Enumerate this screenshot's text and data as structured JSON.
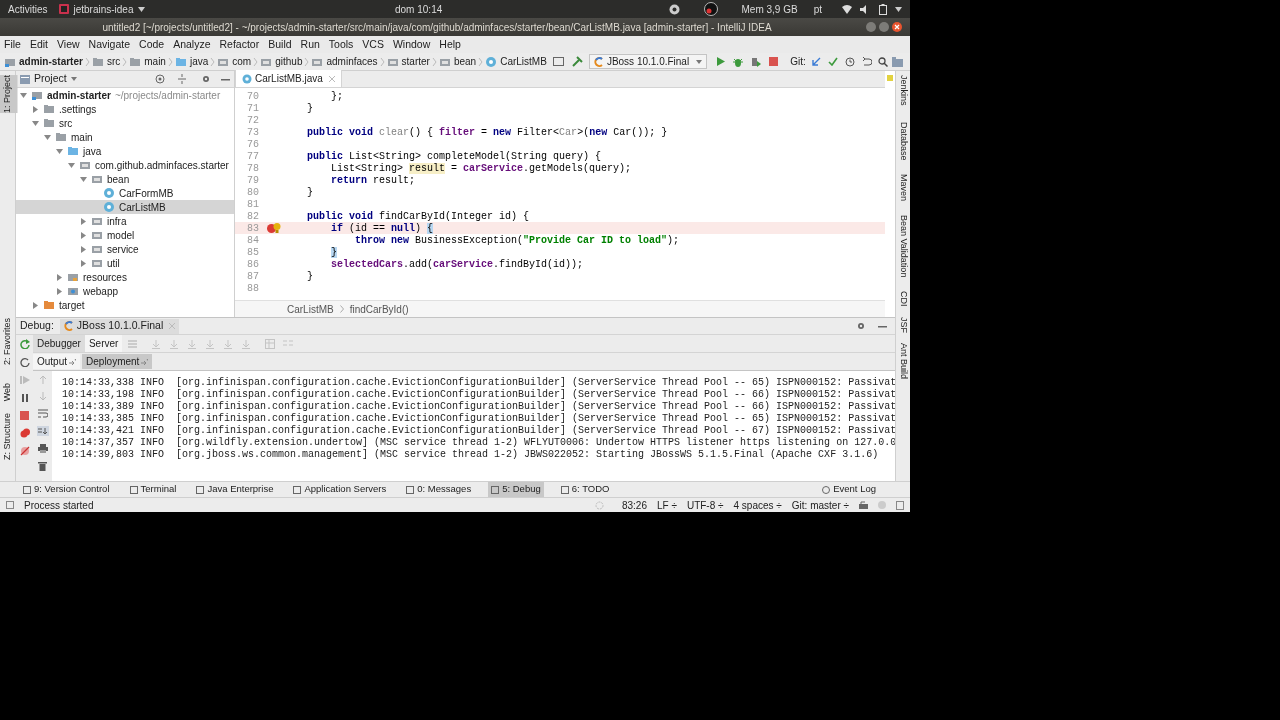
{
  "system_bar": {
    "activities": "Activities",
    "app": "jetbrains-idea",
    "clock": "dom 10:14",
    "memory": "Mem 3,9 GB",
    "language": "pt"
  },
  "window": {
    "title": "untitled2 [~/projects/untitled2] - ~/projects/admin-starter/src/main/java/com/github/adminfaces/starter/bean/CarListMB.java [admin-starter] - IntelliJ IDEA"
  },
  "menu": [
    "File",
    "Edit",
    "View",
    "Navigate",
    "Code",
    "Analyze",
    "Refactor",
    "Build",
    "Run",
    "Tools",
    "VCS",
    "Window",
    "Help"
  ],
  "breadcrumbs": [
    {
      "label": "admin-starter",
      "kind": "module"
    },
    {
      "label": "src",
      "kind": "folder"
    },
    {
      "label": "main",
      "kind": "folder"
    },
    {
      "label": "java",
      "kind": "source"
    },
    {
      "label": "com",
      "kind": "package"
    },
    {
      "label": "github",
      "kind": "package"
    },
    {
      "label": "adminfaces",
      "kind": "package"
    },
    {
      "label": "starter",
      "kind": "package"
    },
    {
      "label": "bean",
      "kind": "package"
    },
    {
      "label": "CarListMB",
      "kind": "class"
    }
  ],
  "run_config": "JBoss 10.1.0.Final",
  "git_label": "Git:",
  "left_tool_windows": [
    {
      "label": "1: Project",
      "selected": true
    },
    {
      "label": "2: Favorites",
      "selected": false
    },
    {
      "label": "Web",
      "selected": false
    },
    {
      "label": "Z: Structure",
      "selected": false
    }
  ],
  "project_panel": {
    "title": "Project",
    "tree": [
      {
        "label": "admin-starter",
        "note": "~/projects/admin-starter",
        "kind": "module",
        "expanded": true,
        "selected": false,
        "children": [
          {
            "label": ".settings",
            "kind": "folder",
            "expanded": false,
            "selected": false
          },
          {
            "label": "src",
            "kind": "folder",
            "expanded": true,
            "selected": false,
            "children": [
              {
                "label": "main",
                "kind": "folder",
                "expanded": true,
                "selected": false,
                "children": [
                  {
                    "label": "java",
                    "kind": "source",
                    "expanded": true,
                    "selected": false,
                    "children": [
                      {
                        "label": "com.github.adminfaces.starter",
                        "kind": "package",
                        "expanded": true,
                        "selected": false,
                        "children": [
                          {
                            "label": "bean",
                            "kind": "package",
                            "expanded": true,
                            "selected": false,
                            "children": [
                              {
                                "label": "CarFormMB",
                                "kind": "class",
                                "selected": false
                              },
                              {
                                "label": "CarListMB",
                                "kind": "class",
                                "selected": true
                              }
                            ]
                          },
                          {
                            "label": "infra",
                            "kind": "package",
                            "expanded": false,
                            "selected": false
                          },
                          {
                            "label": "model",
                            "kind": "package",
                            "expanded": false,
                            "selected": false
                          },
                          {
                            "label": "service",
                            "kind": "package",
                            "expanded": false,
                            "selected": false
                          },
                          {
                            "label": "util",
                            "kind": "package",
                            "expanded": false,
                            "selected": false
                          }
                        ]
                      }
                    ]
                  },
                  {
                    "label": "resources",
                    "kind": "resources",
                    "expanded": false,
                    "selected": false
                  },
                  {
                    "label": "webapp",
                    "kind": "webapp",
                    "expanded": false,
                    "selected": false
                  }
                ]
              }
            ]
          },
          {
            "label": "target",
            "kind": "excluded",
            "expanded": false,
            "selected": false
          }
        ]
      }
    ]
  },
  "editor": {
    "tabs": [
      {
        "label": "CarListMB.java",
        "selected": true
      }
    ],
    "lines": [
      {
        "number": "70",
        "current": false,
        "breakpoint": false,
        "tokens": [
          {
            "kind": "plain",
            "text": "        };"
          }
        ]
      },
      {
        "number": "71",
        "current": false,
        "breakpoint": false,
        "tokens": [
          {
            "kind": "plain",
            "text": "    }"
          }
        ]
      },
      {
        "number": "72",
        "current": false,
        "breakpoint": false
      },
      {
        "number": "73",
        "current": false,
        "breakpoint": false,
        "tokens": [
          {
            "kind": "keyword",
            "text": "    public void "
          },
          {
            "kind": "unused",
            "text": "clear"
          },
          {
            "kind": "plain",
            "text": "() { "
          },
          {
            "kind": "field",
            "text": "filter"
          },
          {
            "kind": "plain",
            "text": " = "
          },
          {
            "kind": "keyword",
            "text": "new "
          },
          {
            "kind": "plain",
            "text": "Filter<"
          },
          {
            "kind": "unused",
            "text": "Car"
          },
          {
            "kind": "plain",
            "text": ">("
          },
          {
            "kind": "keyword",
            "text": "new "
          },
          {
            "kind": "plain",
            "text": "Car()); }"
          }
        ]
      },
      {
        "number": "76",
        "current": false,
        "breakpoint": false
      },
      {
        "number": "77",
        "current": false,
        "breakpoint": false,
        "tokens": [
          {
            "kind": "keyword",
            "text": "    public "
          },
          {
            "kind": "plain",
            "text": "List<String> completeModel(String query) {"
          }
        ]
      },
      {
        "number": "78",
        "current": false,
        "breakpoint": false,
        "tokens": [
          {
            "kind": "plain",
            "text": "        List<String> "
          },
          {
            "kind": "highlight",
            "text": "result"
          },
          {
            "kind": "plain",
            "text": " = "
          },
          {
            "kind": "field",
            "text": "carService"
          },
          {
            "kind": "plain",
            "text": ".getModels(query);"
          }
        ]
      },
      {
        "number": "79",
        "current": false,
        "breakpoint": false,
        "tokens": [
          {
            "kind": "keyword",
            "text": "        return "
          },
          {
            "kind": "plain",
            "text": "result;"
          }
        ]
      },
      {
        "number": "80",
        "current": false,
        "breakpoint": false,
        "tokens": [
          {
            "kind": "plain",
            "text": "    }"
          }
        ]
      },
      {
        "number": "81",
        "current": false,
        "breakpoint": false
      },
      {
        "number": "82",
        "current": false,
        "breakpoint": false,
        "tokens": [
          {
            "kind": "keyword",
            "text": "    public void "
          },
          {
            "kind": "plain",
            "text": "findCarById(Integer id) {"
          }
        ]
      },
      {
        "number": "83",
        "current": true,
        "breakpoint": true,
        "tokens": [
          {
            "kind": "keyword",
            "text": "        if "
          },
          {
            "kind": "plain",
            "text": "(id == "
          },
          {
            "kind": "keyword",
            "text": "null"
          },
          {
            "kind": "plain",
            "text": ") "
          },
          {
            "kind": "match",
            "text": "{"
          }
        ]
      },
      {
        "number": "84",
        "current": false,
        "breakpoint": false,
        "tokens": [
          {
            "kind": "keyword",
            "text": "            throw new "
          },
          {
            "kind": "plain",
            "text": "BusinessException("
          },
          {
            "kind": "string",
            "text": "\"Provide Car ID to load\""
          },
          {
            "kind": "plain",
            "text": ");"
          }
        ]
      },
      {
        "number": "85",
        "current": false,
        "breakpoint": false,
        "tokens": [
          {
            "kind": "match",
            "text": "        }"
          }
        ]
      },
      {
        "number": "86",
        "current": false,
        "breakpoint": false,
        "tokens": [
          {
            "kind": "field",
            "text": "        selectedCars"
          },
          {
            "kind": "plain",
            "text": ".add("
          },
          {
            "kind": "field",
            "text": "carService"
          },
          {
            "kind": "plain",
            "text": ".findById(id));"
          }
        ]
      },
      {
        "number": "87",
        "current": false,
        "breakpoint": false,
        "tokens": [
          {
            "kind": "plain",
            "text": "    }"
          }
        ]
      },
      {
        "number": "88",
        "current": false,
        "breakpoint": false
      }
    ],
    "breadcrumbs": [
      "CarListMB",
      "findCarById()"
    ]
  },
  "right_tool_windows": [
    "Jenkins",
    "Database",
    "Maven",
    "Bean Validation",
    "CDI",
    "JSF",
    "Ant Build"
  ],
  "debug": {
    "label": "Debug:",
    "session": "JBoss 10.1.0.Final",
    "tabs": [
      {
        "label": "Debugger",
        "selected": false
      },
      {
        "label": "Server",
        "selected": true
      }
    ],
    "subtabs": [
      {
        "label": "Output",
        "selected": true
      },
      {
        "label": "Deployment",
        "selected": false
      }
    ],
    "console": [
      "10:14:33,338 INFO  [org.infinispan.configuration.cache.EvictionConfigurationBuilder] (ServerService Thread Pool -- 65) ISPN000152: Passivat",
      "10:14:33,198 INFO  [org.infinispan.configuration.cache.EvictionConfigurationBuilder] (ServerService Thread Pool -- 66) ISPN000152: Passivat",
      "10:14:33,389 INFO  [org.infinispan.configuration.cache.EvictionConfigurationBuilder] (ServerService Thread Pool -- 66) ISPN000152: Passivat",
      "10:14:33,385 INFO  [org.infinispan.configuration.cache.EvictionConfigurationBuilder] (ServerService Thread Pool -- 65) ISPN000152: Passivat",
      "10:14:33,421 INFO  [org.infinispan.configuration.cache.EvictionConfigurationBuilder] (ServerService Thread Pool -- 67) ISPN000152: Passivat",
      "10:14:37,357 INFO  [org.wildfly.extension.undertow] (MSC service thread 1-2) WFLYUT0006: Undertow HTTPS listener https listening on 127.0.0",
      "10:14:39,803 INFO  [org.jboss.ws.common.management] (MSC service thread 1-2) JBWS022052: Starting JBossWS 5.1.5.Final (Apache CXF 3.1.6)"
    ]
  },
  "bottom_tabs": [
    {
      "label": "9: Version Control",
      "selected": false
    },
    {
      "label": "Terminal",
      "selected": false
    },
    {
      "label": "Java Enterprise",
      "selected": false
    },
    {
      "label": "Application Servers",
      "selected": false
    },
    {
      "label": "0: Messages",
      "selected": false
    },
    {
      "label": "5: Debug",
      "selected": true
    },
    {
      "label": "6: TODO",
      "selected": false
    }
  ],
  "event_log": "Event Log",
  "status_bar": {
    "message": "Process started",
    "position": "83:26",
    "line_separator": "LF ÷",
    "encoding": "UTF-8 ÷",
    "indent": "4 spaces ÷",
    "git": "Git: master ÷"
  }
}
